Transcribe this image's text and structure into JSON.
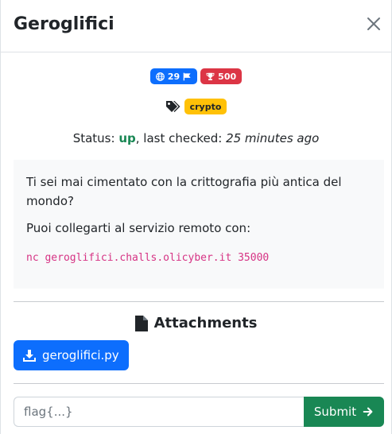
{
  "modal": {
    "title": "Geroglifici"
  },
  "badges": {
    "solves": "29",
    "points": "500"
  },
  "tags": [
    "crypto"
  ],
  "status": {
    "prefix": "Status: ",
    "state": "up",
    "middle": ", last checked: ",
    "checked": "25 minutes ago"
  },
  "description": {
    "paragraph1": "Ti sei mai cimentato con la crittografia più antica del mondo?",
    "paragraph2": "Puoi collegarti al servizio remoto con:",
    "command": "nc geroglifici.challs.olicyber.it 35000"
  },
  "attachments": {
    "heading": "Attachments",
    "files": [
      "geroglifici.py"
    ]
  },
  "flag": {
    "placeholder": "flag{...}",
    "value": "",
    "submit_label": "Submit"
  },
  "colors": {
    "primary": "#0d6efd",
    "danger": "#dc3545",
    "warning": "#ffc107",
    "success": "#198754",
    "code": "#d63384"
  },
  "icons": [
    "close-icon",
    "globe-icon",
    "flag-icon",
    "trophy-icon",
    "tags-icon",
    "file-icon",
    "download-icon",
    "arrow-right-icon"
  ]
}
